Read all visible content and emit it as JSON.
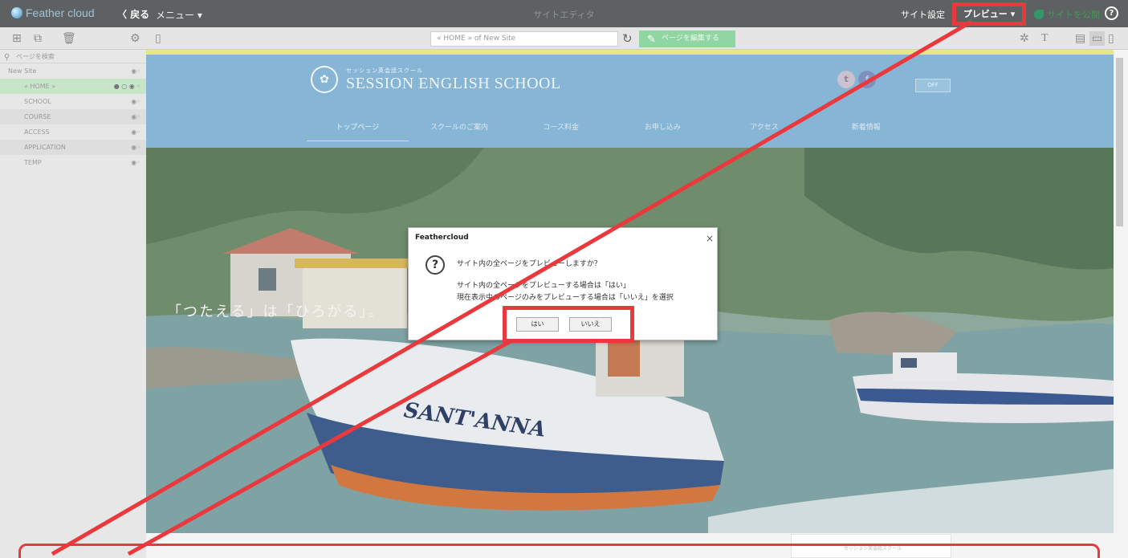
{
  "topbar": {
    "logo_text": "Feather cloud",
    "back_label": "〈 戻る",
    "menu_label": "メニュー ▾",
    "center_title": "サイトエディタ",
    "site_settings": "サイト設定",
    "preview_label": "プレビュー",
    "preview_caret": "▾",
    "publish_label": "サイトを公開",
    "help_icon": "?"
  },
  "toolbar": {
    "url_text": "« HOME » of New Site",
    "edit_label": "ページを編集する"
  },
  "sidebar": {
    "search_placeholder": "ページを検索",
    "site_label": "New Site",
    "home_label": "« HOME »",
    "pages": [
      "SCHOOL",
      "COURSE",
      "ACCESS",
      "APPLICATION",
      "TEMP"
    ]
  },
  "site": {
    "logo_sub": "セッション英会話スクール",
    "logo_name": "SESSION ENGLISH SCHOOL",
    "social_twitter": "t",
    "social_facebook": "f",
    "off_label": "OFF",
    "nav": [
      "トップページ",
      "スクールのご案内",
      "コース料金",
      "お申し込み",
      "アクセス",
      "新着情報"
    ],
    "hero_text": "「つたえる」は「ひろがる」。",
    "boat_name": "SANT'ANNA",
    "mini_logo_text": "セッション英会話スクール"
  },
  "dialog": {
    "title": "Feathercloud",
    "close": "×",
    "question": "サイト内の全ページをプレビューしますか？",
    "detail_1": "サイト内の全ページをプレビューする場合は「はい」",
    "detail_2": "現在表示中のページのみをプレビューする場合は「いいえ」を選択",
    "yes_label": "はい",
    "no_label": "いいえ"
  },
  "colors": {
    "annotation_red": "#e9393c",
    "topbar_bg": "#5d6162",
    "edit_green": "#8fd6a2",
    "header_blue": "#87b5d6"
  }
}
